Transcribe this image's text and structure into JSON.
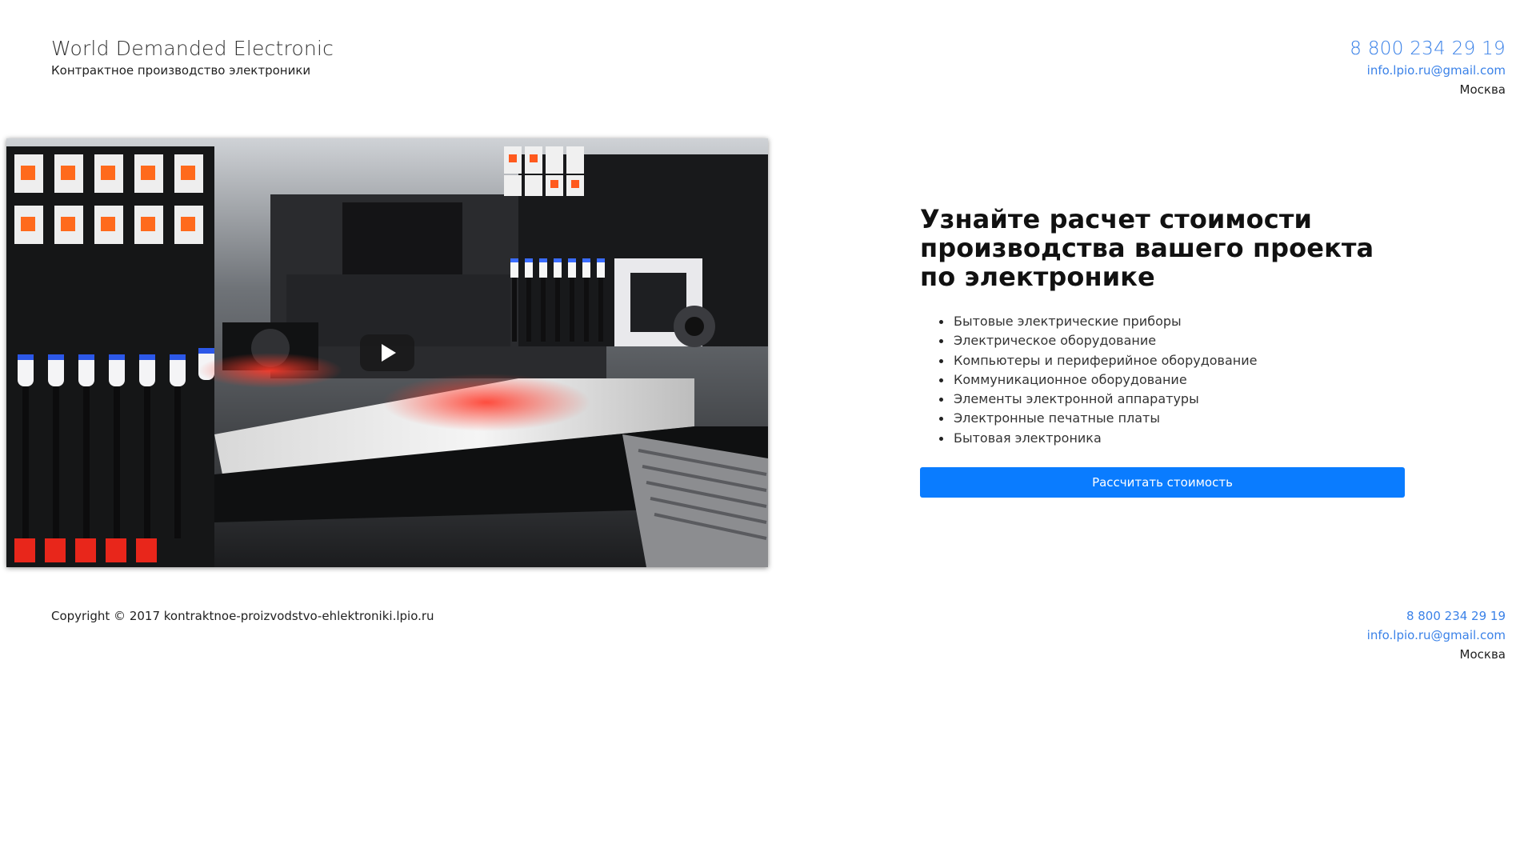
{
  "header": {
    "brand_title": "World Demanded Electronic",
    "brand_subtitle": "Контрактное производство электроники",
    "phone": "8 800 234 29 19",
    "email": "info.lpio.ru@gmail.com",
    "city": "Москва"
  },
  "video": {
    "play_icon": "play-icon"
  },
  "promo": {
    "title": "Узнайте расчет стоимости производства вашего проекта по электронике",
    "items": [
      "Бытовые электрические приборы",
      "Электрическое оборудование",
      "Компьютеры и периферийное оборудование",
      "Коммуникационное оборудование",
      "Элементы электронной аппаратуры",
      "Электронные печатные платы",
      "Бытовая электроника"
    ],
    "button_label": "Рассчитать стоимость"
  },
  "footer": {
    "copyright": "Copyright © 2017 kontraktnoe-proizvodstvo-ehlektroniki.lpio.ru",
    "phone": "8 800 234 29 19",
    "email": "info.lpio.ru@gmail.com",
    "city": "Москва"
  },
  "colors": {
    "link": "#3b82e8",
    "button": "#0a7cff",
    "text": "#222222"
  }
}
